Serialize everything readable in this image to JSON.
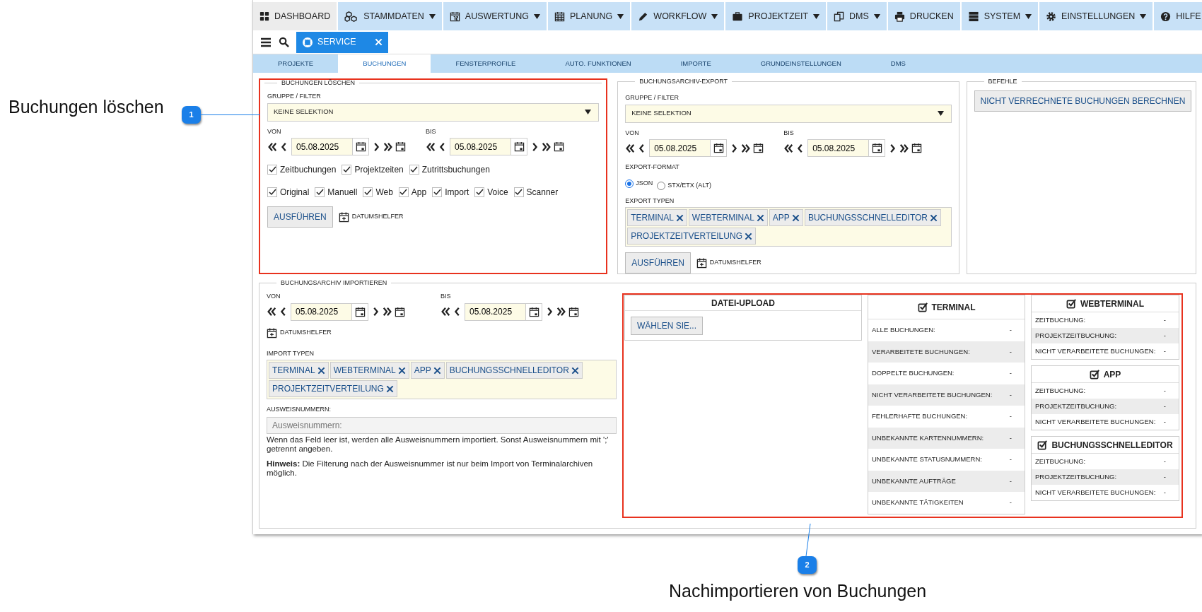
{
  "annotations": [
    {
      "number": "1",
      "text": "Buchungen löschen"
    },
    {
      "number": "2",
      "text": "Nachimportieren von Buchungen"
    }
  ],
  "main_menu": [
    {
      "label": "DASHBOARD",
      "dropdown": false,
      "selected": true
    },
    {
      "label": "STAMMDATEN",
      "dropdown": true,
      "selected": false
    },
    {
      "label": "AUSWERTUNG",
      "dropdown": true,
      "selected": false
    },
    {
      "label": "PLANUNG",
      "dropdown": true,
      "selected": false
    },
    {
      "label": "WORKFLOW",
      "dropdown": true,
      "selected": false
    },
    {
      "label": "PROJEKTZEIT",
      "dropdown": true,
      "selected": false
    },
    {
      "label": "DMS",
      "dropdown": true,
      "selected": false
    },
    {
      "label": "DRUCKEN",
      "dropdown": false,
      "selected": false
    },
    {
      "label": "SYSTEM",
      "dropdown": true,
      "selected": false
    },
    {
      "label": "EINSTELLUNGEN",
      "dropdown": true,
      "selected": false
    },
    {
      "label": "HILFE",
      "dropdown": false,
      "selected": false
    }
  ],
  "open_tabs": [
    {
      "label": "SERVICE",
      "selected": true
    }
  ],
  "sub_tabs": [
    {
      "label": "PROJEKTE",
      "selected": false
    },
    {
      "label": "BUCHUNGEN",
      "selected": true
    },
    {
      "label": "FENSTERPROFILE",
      "selected": false
    },
    {
      "label": "AUTO. FUNKTIONEN",
      "selected": false
    },
    {
      "label": "IMPORTE",
      "selected": false
    },
    {
      "label": "GRUNDEINSTELLUNGEN",
      "selected": false
    },
    {
      "label": "DMS",
      "selected": false
    }
  ],
  "delete_panel": {
    "title": "BUCHUNGEN LÖSCHEN",
    "filter_label": "GRUPPE / FILTER",
    "filter_value": "KEINE SELEKTION",
    "from": {
      "label": "VON",
      "date": "05.08.2025"
    },
    "to": {
      "label": "BIS",
      "date": "05.08.2025"
    },
    "checkbox_rows": [
      [
        {
          "label": "Zeitbuchungen",
          "checked": true
        },
        {
          "label": "Projektzeiten",
          "checked": true
        },
        {
          "label": "Zutrittsbuchungen",
          "checked": true
        }
      ],
      [
        {
          "label": "Original",
          "checked": true
        },
        {
          "label": "Manuell",
          "checked": true
        },
        {
          "label": "Web",
          "checked": true
        },
        {
          "label": "App",
          "checked": true
        },
        {
          "label": "Import",
          "checked": true
        },
        {
          "label": "Voice",
          "checked": true
        },
        {
          "label": "Scanner",
          "checked": true
        }
      ]
    ],
    "run_button": "AUSFÜHREN",
    "date_helper": "DATUMSHELFER"
  },
  "export_panel": {
    "title": "BUCHUNGSARCHIV-EXPORT",
    "filter_label": "GRUPPE / FILTER",
    "filter_value": "KEINE SELEKTION",
    "from": {
      "label": "VON",
      "date": "05.08.2025"
    },
    "to": {
      "label": "BIS",
      "date": "05.08.2025"
    },
    "format_label": "EXPORT-FORMAT",
    "formats": [
      {
        "label": "JSON",
        "selected": true
      },
      {
        "label": "STX/ETX (ALT)",
        "selected": false
      }
    ],
    "types_label": "EXPORT TYPEN",
    "types": [
      "TERMINAL",
      "WEBTERMINAL",
      "APP",
      "BUCHUNGSSCHNELLEDITOR",
      "PROJEKTZEITVERTEILUNG"
    ],
    "run_button": "AUSFÜHREN",
    "date_helper": "DATUMSHELFER"
  },
  "commands_panel": {
    "title": "BEFEHLE",
    "buttons": [
      "NICHT VERRECHNETE BUCHUNGEN BERECHNEN"
    ]
  },
  "import_panel": {
    "title": "BUCHUNGSARCHIV IMPORTIEREN",
    "from": {
      "label": "VON",
      "date": "05.08.2025"
    },
    "to": {
      "label": "BIS",
      "date": "05.08.2025"
    },
    "date_helper": "DATUMSHELFER",
    "types_label": "IMPORT TYPEN",
    "types": [
      "TERMINAL",
      "WEBTERMINAL",
      "APP",
      "BUCHUNGSSCHNELLEDITOR",
      "PROJEKTZEITVERTEILUNG"
    ],
    "id_label": "AUSWEISNUMMERN:",
    "id_placeholder": "Ausweisnummern:",
    "help_text": "Wenn das Feld leer ist, werden alle Ausweisnummern importiert. Sonst Ausweisnummern mit ';' getrennt angeben.",
    "note": "**Hinweis:** Die Filterung nach der Ausweisnummer ist nur beim Import von Terminalarchiven möglich.",
    "upload": {
      "title": "DATEI-UPLOAD",
      "button": "WÄHLEN SIE..."
    },
    "terminal": {
      "title": "TERMINAL",
      "checked": true,
      "rows": [
        {
          "label": "ALLE BUCHUNGEN:",
          "value": "-"
        },
        {
          "label": "VERARBEITETE BUCHUNGEN:",
          "value": "-"
        },
        {
          "label": "DOPPELTE BUCHUNGEN:",
          "value": "-"
        },
        {
          "label": "NICHT VERARBEITETE BUCHUNGEN:",
          "value": "-"
        },
        {
          "label": "FEHLERHAFTE BUCHUNGEN:",
          "value": "-"
        },
        {
          "label": "UNBEKANNTE KARTENNUMMERN:",
          "value": "-"
        },
        {
          "label": "UNBEKANNTE STATUSNUMMERN:",
          "value": "-"
        },
        {
          "label": "UNBEKANNTE AUFTRÄGE",
          "value": "-"
        },
        {
          "label": "UNBEKANNTE TÄTIGKEITEN",
          "value": "-"
        }
      ]
    },
    "sources": [
      {
        "title": "WEBTERMINAL",
        "checked": true,
        "rows": [
          {
            "label": "ZEITBUCHUNG:",
            "value": "-"
          },
          {
            "label": "PROJEKTZEITBUCHUNG:",
            "value": "-"
          },
          {
            "label": "NICHT VERARBEITETE BUCHUNGEN:",
            "value": "-"
          }
        ]
      },
      {
        "title": "APP",
        "checked": true,
        "rows": [
          {
            "label": "ZEITBUCHUNG:",
            "value": "-"
          },
          {
            "label": "PROJEKTZEITBUCHUNG:",
            "value": "-"
          },
          {
            "label": "NICHT VERARBEITETE BUCHUNGEN:",
            "value": "-"
          }
        ]
      },
      {
        "title": "BUCHUNGSSCHNELLEDITOR",
        "checked": true,
        "rows": [
          {
            "label": "ZEITBUCHUNG:",
            "value": "-"
          },
          {
            "label": "PROJEKTZEITBUCHUNG:",
            "value": "-"
          },
          {
            "label": "NICHT VERARBEITETE BUCHUNGEN:",
            "value": "-"
          }
        ]
      }
    ]
  }
}
